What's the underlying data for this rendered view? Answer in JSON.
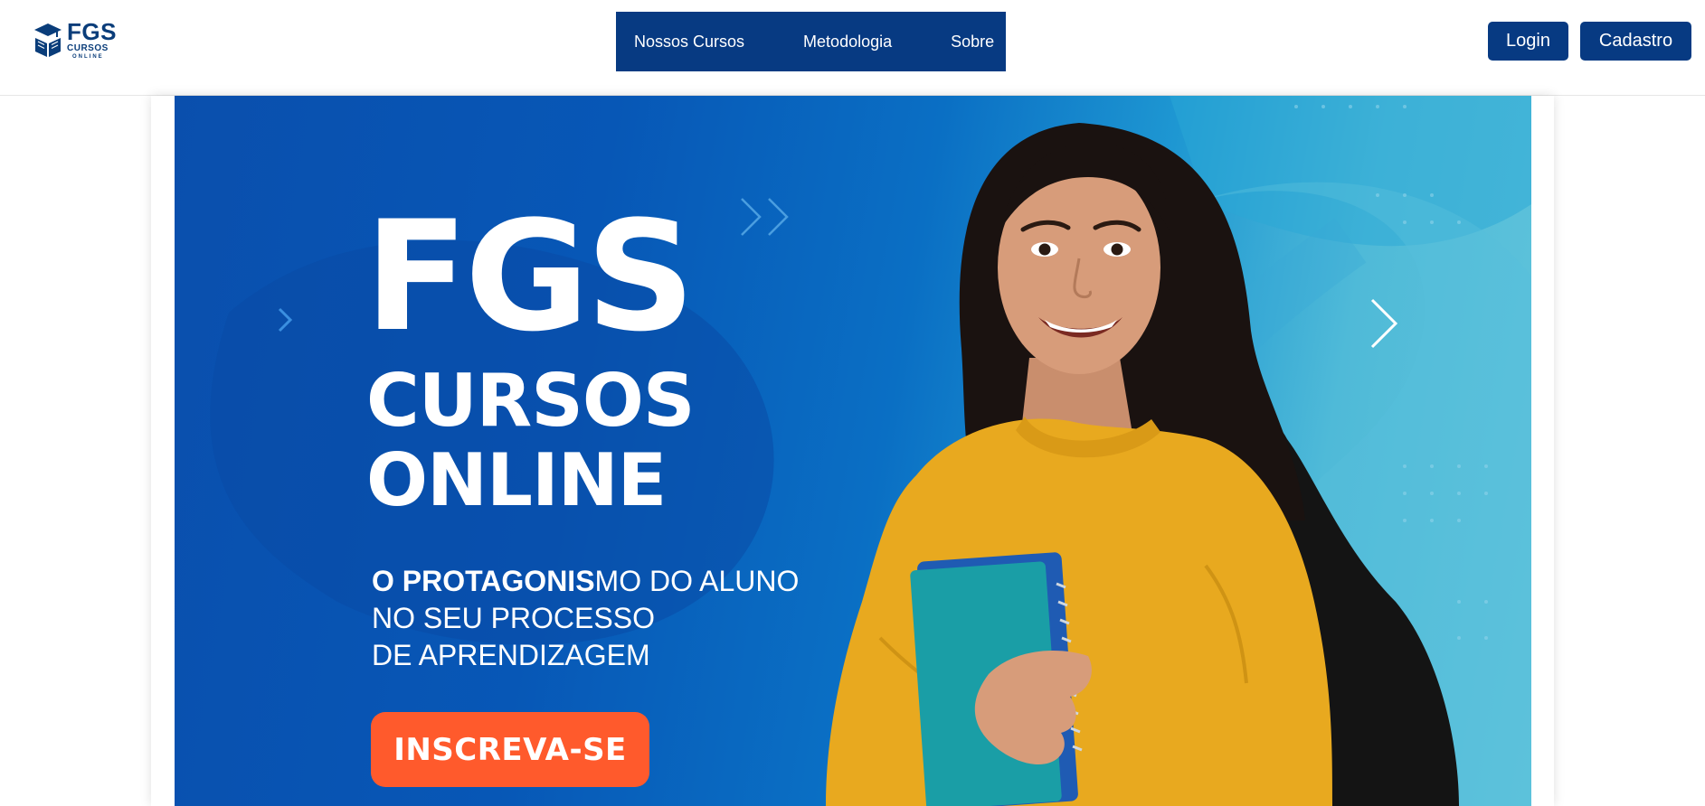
{
  "header": {
    "logo": {
      "main": "FGS",
      "sub1": "CURSOS",
      "sub2": "ONLINE",
      "icon": "graduation-book-icon"
    },
    "nav": [
      {
        "label": "Nossos Cursos"
      },
      {
        "label": "Metodologia"
      },
      {
        "label": "Sobre"
      }
    ],
    "login_label": "Login",
    "cadastro_label": "Cadastro"
  },
  "banner": {
    "title": "FGS",
    "title_line2": "CURSOS",
    "title_line3": "ONLINE",
    "tagline_bold": "O PROTAGONIS",
    "tagline_rest": "MO DO ALUNO",
    "tagline_line2": "NO SEU PROCESSO",
    "tagline_line3": "DE APRENDIZAGEM",
    "cta_label": "INSCREVA-SE",
    "image": "smiling-student-with-notebook-and-backpack"
  },
  "colors": {
    "brand_navy": "#073a82",
    "banner_blue": "#0a4fad",
    "banner_teal": "#62c5db",
    "cta_orange": "#ff5a2c"
  }
}
